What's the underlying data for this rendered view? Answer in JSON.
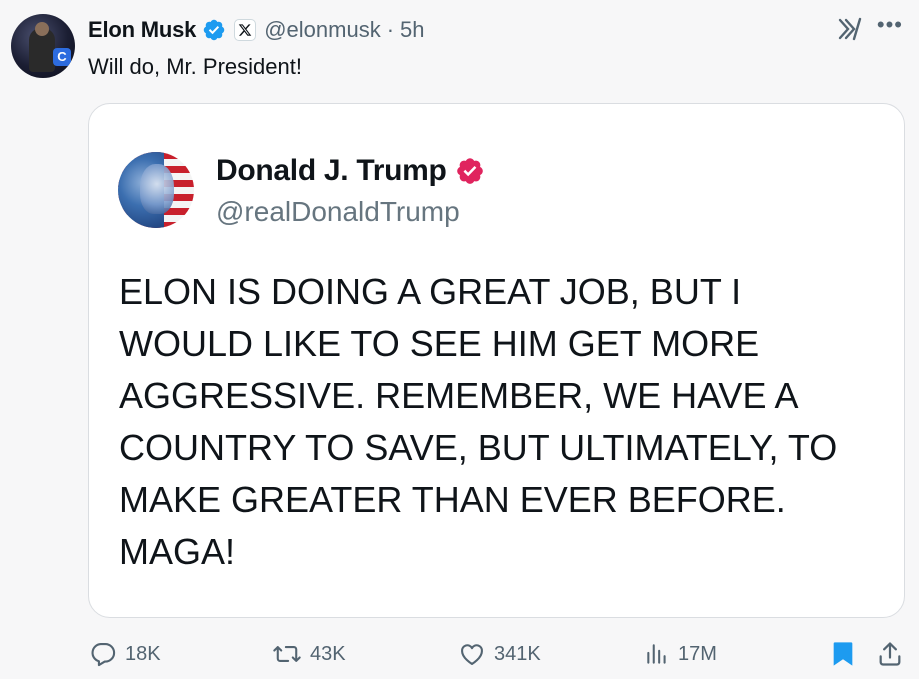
{
  "post": {
    "author": {
      "name": "Elon Musk",
      "handle": "@elonmusk",
      "time": "5h",
      "separator": "·",
      "avatar_badge": "C"
    },
    "text": "Will do, Mr. President!",
    "quoted": {
      "name": "Donald J. Trump",
      "handle": "@realDonaldTrump",
      "body_lines": [
        "ELON IS DOING A GREAT JOB, BUT I",
        "WOULD LIKE TO SEE HIM GET MORE",
        "AGGRESSIVE. REMEMBER, WE HAVE A",
        "COUNTRY TO SAVE, BUT ULTIMATELY, TO",
        "MAKE GREATER THAN EVER BEFORE.",
        "MAGA!"
      ]
    },
    "stats": {
      "replies": "18K",
      "reposts": "43K",
      "likes": "341K",
      "views": "17M"
    }
  },
  "icons": {
    "verified": "verified-badge-icon",
    "x_affiliation": "x-logo-icon",
    "grok": "grok-icon",
    "more": "more-icon",
    "reply": "reply-icon",
    "repost": "repost-icon",
    "like": "like-icon",
    "views": "views-icon",
    "bookmark": "bookmark-icon",
    "share": "share-icon"
  },
  "colors": {
    "verified_blue": "#1d9bf0",
    "verified_pink": "#e0245e",
    "bookmark_active": "#1d9bf0",
    "muted_text": "#536471"
  }
}
